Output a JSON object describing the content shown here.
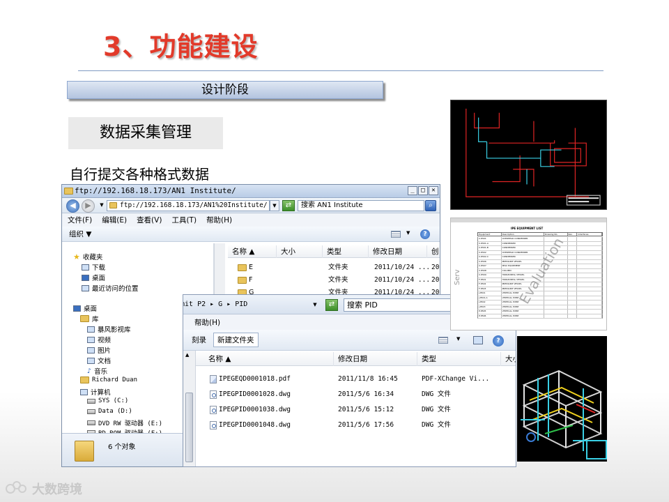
{
  "slide": {
    "title": "3、功能建设",
    "phase": "设计阶段",
    "module": "数据采集管理",
    "subtitle": "自行提交各种格式数据"
  },
  "window_back": {
    "title": "ftp://192.168.18.173/AN1 Institute/",
    "address": "ftp://192.168.18.173/AN1%20Institute/",
    "search": "搜索 AN1 Institute",
    "menu": [
      "文件(F)",
      "编辑(E)",
      "查看(V)",
      "工具(T)",
      "帮助(H)"
    ],
    "organize": "组织 ▼",
    "tree": {
      "favorites": "收藏夹",
      "downloads": "下载",
      "desktop_fav": "桌面",
      "recent": "最近访问的位置",
      "desktop": "桌面",
      "library": "库",
      "storm": "暴风影视库",
      "video": "视频",
      "pictures": "图片",
      "documents": "文档",
      "music": "音乐",
      "user": "Richard Duan",
      "computer": "计算机",
      "sys": "SYS (C:)",
      "data": "Data (D:)",
      "dvd": "DVD RW 驱动器 (E:)",
      "bd": "BD-ROM 驱动器 (F:)"
    },
    "columns": [
      "名称",
      "大小",
      "类型",
      "修改日期",
      "创"
    ],
    "rows": [
      {
        "name": "E",
        "type": "文件夹",
        "date": "2011/10/24 ...",
        "extra": "20"
      },
      {
        "name": "F",
        "type": "文件夹",
        "date": "2011/10/24 ...",
        "extra": "20"
      },
      {
        "name": "G",
        "type": "文件夹",
        "date": "2011/10/24 ...",
        "extra": "20"
      }
    ],
    "status": "6 个对象"
  },
  "window_front": {
    "path": "mit P2 ▸ G ▸ PID",
    "search": "搜索 PID",
    "menu_help": "帮助(H)",
    "burn": "刻录",
    "new_folder": "新建文件夹",
    "columns": [
      "名称",
      "修改日期",
      "类型",
      "大小"
    ],
    "rows": [
      {
        "name": "IPEGEQD0001018.pdf",
        "date": "2011/11/8 16:45",
        "type": "PDF-XChange Vi...",
        "kind": "pdf"
      },
      {
        "name": "IPEGPID0001028.dwg",
        "date": "2011/5/6 16:34",
        "type": "DWG 文件",
        "kind": "dwg"
      },
      {
        "name": "IPEGPID0001038.dwg",
        "date": "2011/5/6 15:12",
        "type": "DWG 文件",
        "kind": "dwg"
      },
      {
        "name": "IPEGPID0001048.dwg",
        "date": "2011/5/6 17:56",
        "type": "DWG 文件",
        "kind": "dwg"
      }
    ]
  },
  "thumbnail": {
    "sheet_header": "IPE EQUIPMENT LIST",
    "sheet_columns": [
      "Equipment",
      "Description",
      "Drawing No.",
      "Rev",
      "Interfaces"
    ],
    "sheet_rows": [
      [
        "C-8501",
        "OVERHEAD CONDENSER"
      ],
      [
        "C-8501-A",
        "CONDENSER"
      ],
      [
        "C-8501-B",
        "CONDENSER"
      ],
      [
        "C-8502",
        "OVERHEAD CONDENSER"
      ],
      [
        "C-8502-C",
        "CONDENSER"
      ],
      [
        "C-8506",
        "PRESSURE VESSEL"
      ],
      [
        "C-8507",
        "MISC EQUIPMENT"
      ],
      [
        "C-8508",
        "COLUMN"
      ],
      [
        "C-8509",
        "HORIZONTAL VESSEL"
      ],
      [
        "F-8501",
        "HORIZONTAL VESSEL"
      ],
      [
        "F-8502",
        "PRESSURE VESSEL"
      ],
      [
        "F-8503",
        "PRESSURE VESSEL"
      ],
      [
        "J-8501",
        "VERTICAL PUMP"
      ],
      [
        "J-8501-A",
        "VERTICAL PUMP"
      ],
      [
        "J-8502",
        "VERTICAL PUMP"
      ],
      [
        "J-8503",
        "VERTICAL PUMP"
      ],
      [
        "P-8505",
        "VERTICAL PUMP"
      ],
      [
        "P-8506",
        "VERTICAL PUMP"
      ]
    ],
    "watermark": "Evaluation",
    "side_text": "Serv"
  },
  "logo": {
    "text": "大数跨境"
  },
  "colors": {
    "title": "#e23a2a",
    "cad_cyan": "#3ad1e6",
    "cad_red": "#e02424"
  }
}
